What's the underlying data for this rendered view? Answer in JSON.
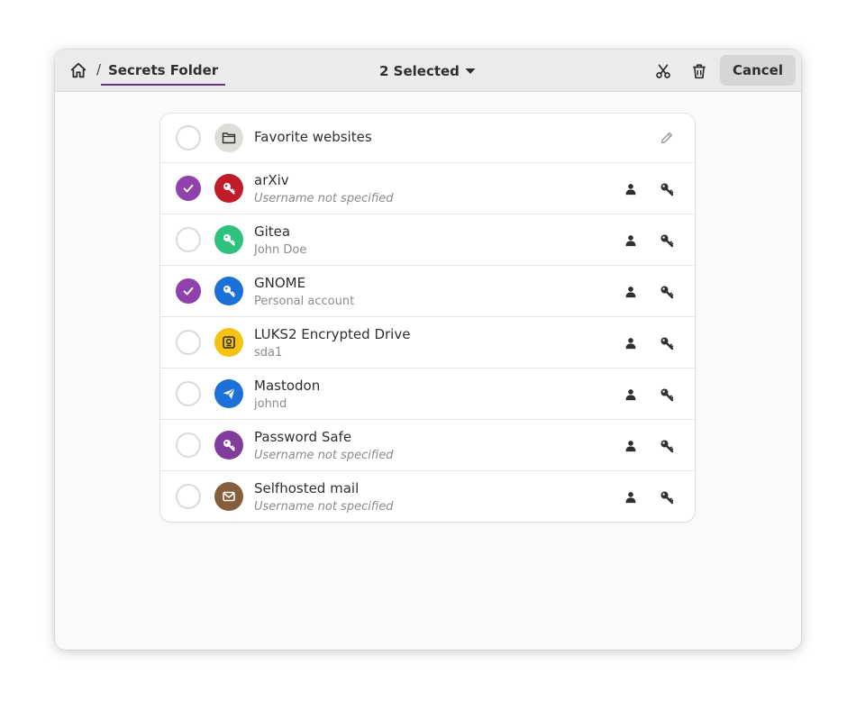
{
  "headerbar": {
    "breadcrumb_separator": "/",
    "folder_name": "Secrets Folder",
    "selection_label": "2 Selected",
    "cancel_label": "Cancel"
  },
  "folder_row": {
    "title": "Favorite websites",
    "icon": "folder-icon"
  },
  "items": [
    {
      "title": "arXiv",
      "subtitle": "Username not specified",
      "selected": true,
      "color": "#c01c28",
      "icon": "key-icon"
    },
    {
      "title": "Gitea",
      "subtitle": "John Doe",
      "selected": false,
      "color": "#2ec27e",
      "icon": "key-icon"
    },
    {
      "title": "GNOME",
      "subtitle": "Personal account",
      "selected": true,
      "color": "#1c71d8",
      "icon": "key-icon"
    },
    {
      "title": "LUKS2 Encrypted Drive",
      "subtitle": "sda1",
      "selected": false,
      "color": "#f5c211",
      "icon": "lock-icon"
    },
    {
      "title": "Mastodon",
      "subtitle": "johnd",
      "selected": false,
      "color": "#1c71d8",
      "icon": "send-icon"
    },
    {
      "title": "Password Safe",
      "subtitle": "Username not specified",
      "selected": false,
      "color": "#813d9c",
      "icon": "key-icon"
    },
    {
      "title": "Selfhosted mail",
      "subtitle": "Username not specified",
      "selected": false,
      "color": "#865e3c",
      "icon": "mail-icon"
    }
  ],
  "colors": {
    "accent": "#9141ac",
    "breadcrumb_underline": "#613583"
  }
}
